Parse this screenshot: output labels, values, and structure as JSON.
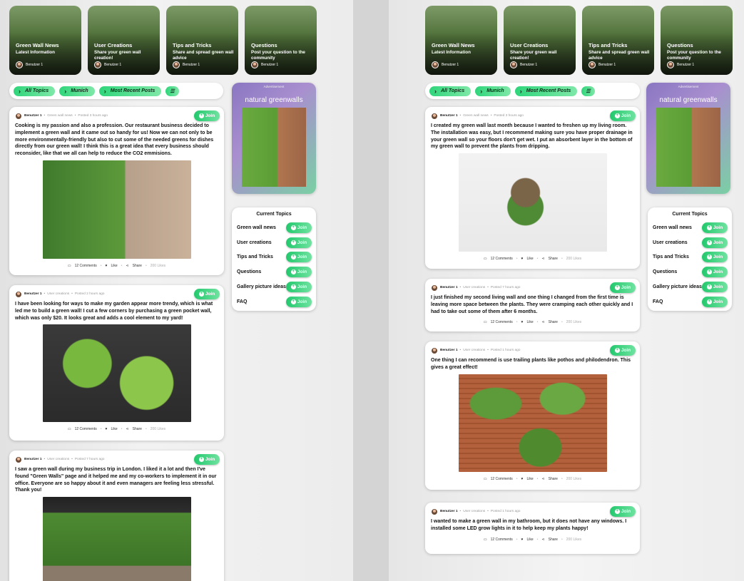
{
  "categories": [
    {
      "title": "Green Wall News",
      "subtitle": "Latest Information",
      "user": "Benutzer 1"
    },
    {
      "title": "User Creations",
      "subtitle": "Share your green wall creation!",
      "user": "Benutzer 1"
    },
    {
      "title": "Tips and Tricks",
      "subtitle": "Share and spread green wall advice",
      "user": "Benutzer 1"
    },
    {
      "title": "Questions",
      "subtitle": "Post your question to the community",
      "user": "Benutzer 1"
    }
  ],
  "filters": {
    "all": "All Topics",
    "location": "Munich",
    "recent": "Most Recent Posts"
  },
  "ad": {
    "label": "Advertisement",
    "brand": "natural greenwalls"
  },
  "topics": {
    "title": "Current Topics",
    "join_label": "Join",
    "items": [
      "Green wall news",
      "User creations",
      "Tips and Tricks",
      "Questions",
      "Gallery picture ideas",
      "FAQ"
    ]
  },
  "post_ui": {
    "join": "Join",
    "comments": "12 Comments",
    "like": "Like",
    "share": "Share",
    "likes": "200 Likes"
  },
  "left_posts": [
    {
      "author": "Benutzer 1",
      "category": "Green wall news",
      "time": "Posted 3 hours ago",
      "text": "Cooking is my passion and also a profession. Our restaurant business decided to implement a green wall and it came out so handy for us! Now we can not only to be more environmentally-friendly but also to cut some of the needed greens for dishes directly from our green wall! I think this is a great idea that every business should reconsider, like that we all can help to reduce the CO2 emmisions."
    },
    {
      "author": "Benutzer 1",
      "category": "User creations",
      "time": "Posted 2 hours ago",
      "text": "I have been looking for ways to make my garden appear more trendy, which is what led me to build a green wall! I cut a few corners by purchasing a green pocket wall, which was only $20. It looks great and adds a cool element to my yard!"
    },
    {
      "author": "Benutzer 1",
      "category": "User creations",
      "time": "Posted 7 hours ago",
      "text": "I saw a green wall during my business trip in London. I liked it a lot and then I've found \"Green Walls\" page and it helped me and my co-workers to implement it in our office. Everyone are so happy about it and even managers are feeling less stressful. Thank you!"
    }
  ],
  "right_posts": [
    {
      "author": "Benutzer 1",
      "category": "Green wall news",
      "time": "Posted 3 hours ago",
      "text": "I created my green wall last month because I wanted to freshen up my living room. The installation was easy, but I recommend making sure you have proper drainage in your green wall so your floors don't get wet. I put an absorbent layer in the bottom of my green wall to prevent the plants from dripping."
    },
    {
      "author": "Benutzer 1",
      "category": "User creations",
      "time": "Posted 7 hours ago",
      "text": "I just finished my second living wall and one thing I changed from the first time is leaving more space between the plants. They were cramping each other quickly and I had to take out some of them after 6 months."
    },
    {
      "author": "Benutzer 1",
      "category": "User creations",
      "time": "Posted 1 hours ago",
      "text": "One thing I can recommend is use trailing plants like pothos and philodendron. This gives a great effect!"
    },
    {
      "author": "Benutzer 1",
      "category": "User creations",
      "time": "Posted 1 hours ago",
      "text": "I wanted to make a green wall in my bathroom, but it does not have any windows. I installed some LED grow lights in it to help keep my plants happy!"
    }
  ]
}
